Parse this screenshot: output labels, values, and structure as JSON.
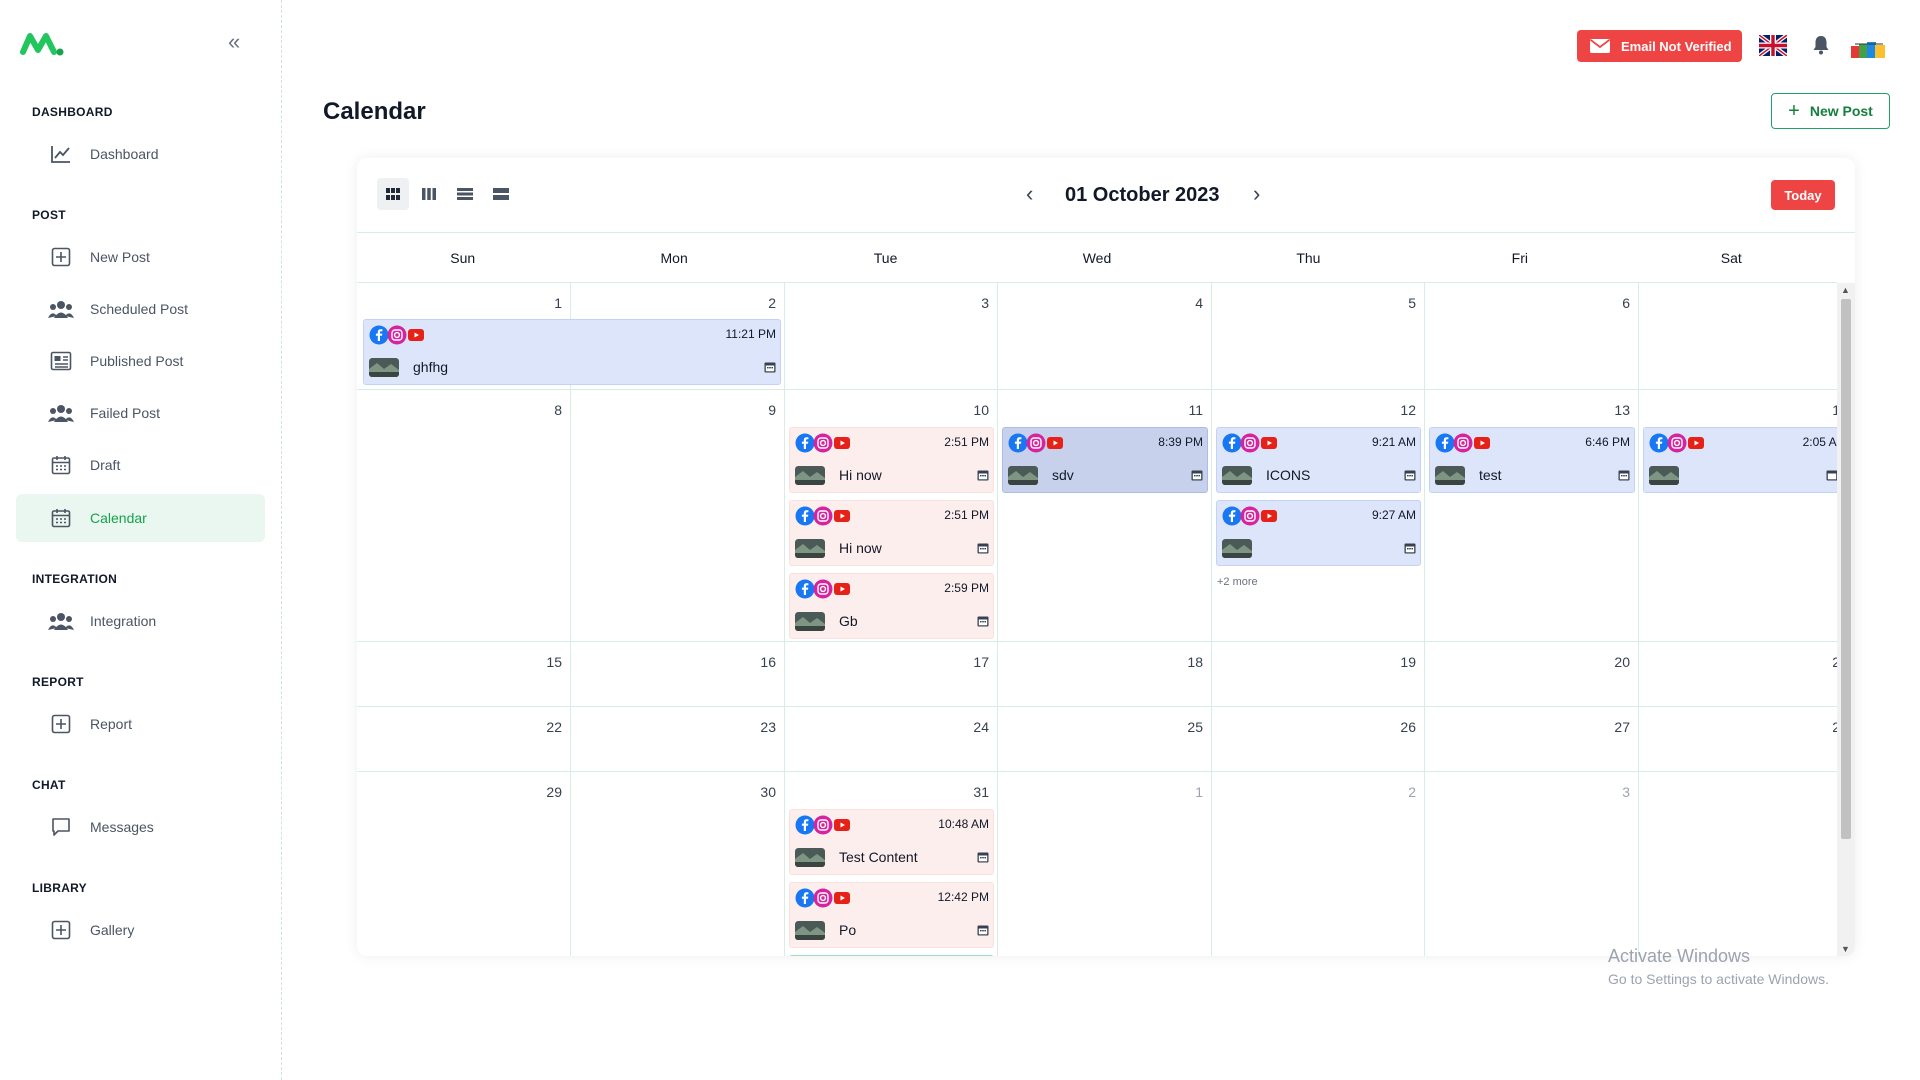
{
  "sidebar": {
    "sections": [
      {
        "title": "DASHBOARD",
        "items": [
          {
            "label": "Dashboard",
            "icon": "chart-line-icon"
          }
        ]
      },
      {
        "title": "POST",
        "items": [
          {
            "label": "New Post",
            "icon": "plus-square-icon"
          },
          {
            "label": "Scheduled Post",
            "icon": "users-icon"
          },
          {
            "label": "Published Post",
            "icon": "newspaper-icon"
          },
          {
            "label": "Failed Post",
            "icon": "users-icon"
          },
          {
            "label": "Draft",
            "icon": "calendar-icon"
          },
          {
            "label": "Calendar",
            "icon": "calendar-icon",
            "active": true
          }
        ]
      },
      {
        "title": "INTEGRATION",
        "items": [
          {
            "label": "Integration",
            "icon": "users-icon"
          }
        ]
      },
      {
        "title": "REPORT",
        "items": [
          {
            "label": "Report",
            "icon": "plus-square-icon"
          }
        ]
      },
      {
        "title": "CHAT",
        "items": [
          {
            "label": "Messages",
            "icon": "message-icon"
          }
        ]
      },
      {
        "title": "LIBRARY",
        "items": [
          {
            "label": "Gallery",
            "icon": "plus-square-icon"
          }
        ]
      }
    ]
  },
  "topbar": {
    "email_status": "Email Not Verified",
    "language_flag": "uk-flag-icon"
  },
  "page": {
    "title": "Calendar",
    "new_post_label": "New Post"
  },
  "calendar": {
    "month_title": "01 October 2023",
    "today_label": "Today",
    "weekdays": [
      "Sun",
      "Mon",
      "Tue",
      "Wed",
      "Thu",
      "Fri",
      "Sat"
    ],
    "weeks": [
      [
        "1",
        "2",
        "3",
        "4",
        "5",
        "6",
        ""
      ],
      [
        "8",
        "9",
        "10",
        "11",
        "12",
        "13",
        "1"
      ],
      [
        "15",
        "16",
        "17",
        "18",
        "19",
        "20",
        "2"
      ],
      [
        "22",
        "23",
        "24",
        "25",
        "26",
        "27",
        "2"
      ],
      [
        "29",
        "30",
        "31",
        "1",
        "2",
        "3",
        ""
      ]
    ],
    "events": {
      "w1_span": {
        "time": "11:21 PM",
        "title": "ghfhg"
      },
      "tue10_a": {
        "time": "2:51 PM",
        "title": "Hi now"
      },
      "tue10_b": {
        "time": "2:51 PM",
        "title": "Hi now"
      },
      "tue10_c": {
        "time": "2:59 PM",
        "title": "Gb"
      },
      "wed11": {
        "time": "8:39 PM",
        "title": "sdv"
      },
      "thu12_a": {
        "time": "9:21 AM",
        "title": "ICONS"
      },
      "thu12_b": {
        "time": "9:27 AM",
        "title": ""
      },
      "fri13": {
        "time": "6:46 PM",
        "title": "test"
      },
      "sat14": {
        "time": "2:05 AI",
        "title": ""
      },
      "tue31_a": {
        "time": "10:48 AM",
        "title": "Test Content"
      },
      "tue31_b": {
        "time": "12:42 PM",
        "title": "Po"
      }
    },
    "more_label": "+2 more"
  },
  "watermark": {
    "line1": "Activate Windows",
    "line2": "Go to Settings to activate Windows."
  },
  "colors": {
    "brand_green": "#16a34a",
    "alert_red": "#ef4444",
    "event_blue": "#dde5fb",
    "event_pink": "#fdeeee"
  }
}
